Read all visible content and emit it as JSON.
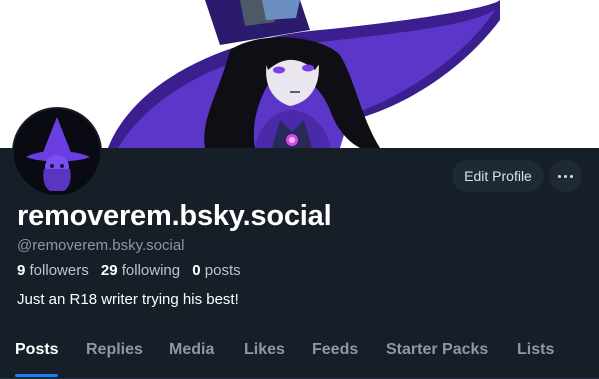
{
  "profile": {
    "display_name": "removerem.bsky.social",
    "handle": "@removerem.bsky.social",
    "followers_count": "9",
    "followers_label": "followers",
    "following_count": "29",
    "following_label": "following",
    "posts_count": "0",
    "posts_label": "posts",
    "bio": "Just an R18 writer trying his best!"
  },
  "actions": {
    "edit_profile_label": "Edit Profile",
    "more_icon": "ellipsis-icon"
  },
  "tabs": [
    {
      "label": "Posts",
      "active": true
    },
    {
      "label": "Replies",
      "active": false
    },
    {
      "label": "Media",
      "active": false
    },
    {
      "label": "Likes",
      "active": false
    },
    {
      "label": "Feeds",
      "active": false
    },
    {
      "label": "Starter Packs",
      "active": false
    },
    {
      "label": "Lists",
      "active": false
    }
  ],
  "colors": {
    "background": "#161e27",
    "button_background": "#1e2936",
    "accent": "#1083fe",
    "muted_text": "#8a98a8",
    "witch_purple": "#4a2aa8"
  }
}
